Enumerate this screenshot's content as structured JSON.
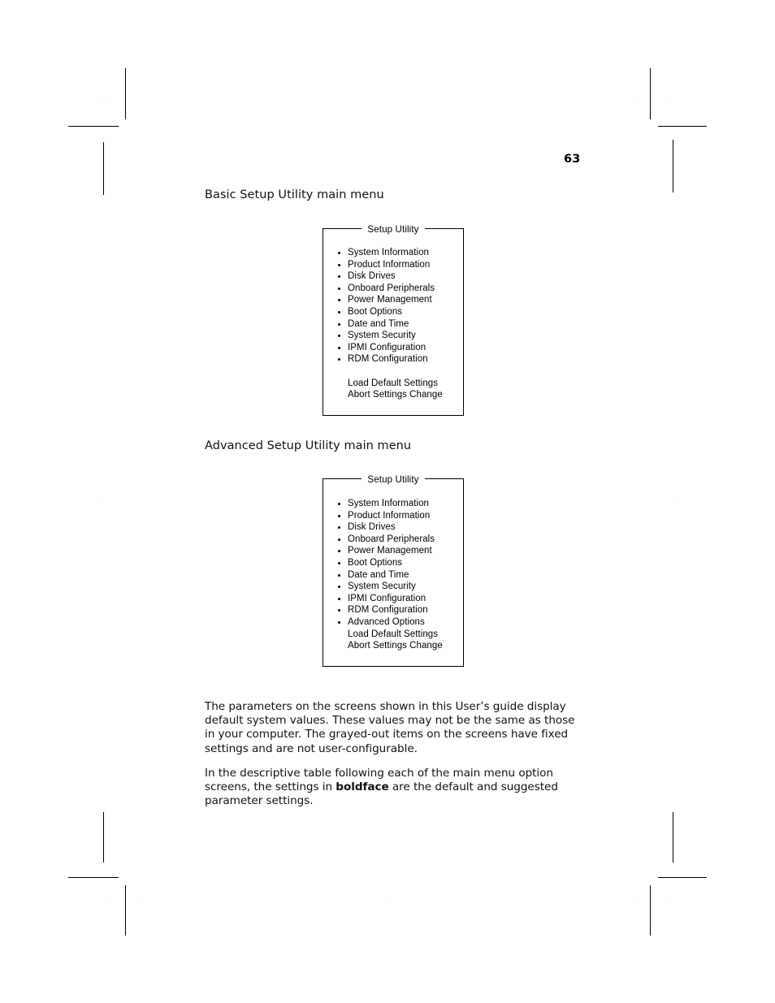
{
  "page": {
    "number": "63"
  },
  "headings": {
    "basic": "Basic Setup Utility main menu",
    "advanced": "Advanced Setup Utility main menu"
  },
  "basic_menu": {
    "title": "Setup Utility",
    "items": [
      "System Information",
      "Product Information",
      "Disk Drives",
      "Onboard Peripherals",
      "Power Management",
      "Boot Options",
      "Date and Time",
      "System Security",
      "IPMI Configuration",
      "RDM Configuration"
    ],
    "actions": [
      "Load Default Settings",
      "Abort Settings Change"
    ]
  },
  "advanced_menu": {
    "title": "Setup Utility",
    "items": [
      "System Information",
      "Product Information",
      "Disk Drives",
      "Onboard Peripherals",
      "Power Management",
      "Boot Options",
      "Date and Time",
      "System Security",
      "IPMI Configuration",
      "RDM Configuration",
      "Advanced Options"
    ],
    "actions": [
      "Load Default Settings",
      "Abort Settings Change"
    ]
  },
  "paragraphs": {
    "p1": "The parameters on the screens shown in this User’s guide display default system values. These values may not be the same as those in your computer. The grayed-out items on the screens have fixed settings and are not user-configurable.",
    "p2_before_bold": "In the descriptive table following each of the main menu option screens, the settings in ",
    "p2_bold": "boldface",
    "p2_after_bold": " are the default and suggested parameter settings."
  },
  "print_marks": {
    "registration_icon": "registration-target-icon",
    "halftone_icon": "halftone-density-patch-icon",
    "trim_icon": "trim-line-icon"
  },
  "colors": {
    "ink": "#000000",
    "paper": "#ffffff",
    "body_text": "#111111"
  }
}
